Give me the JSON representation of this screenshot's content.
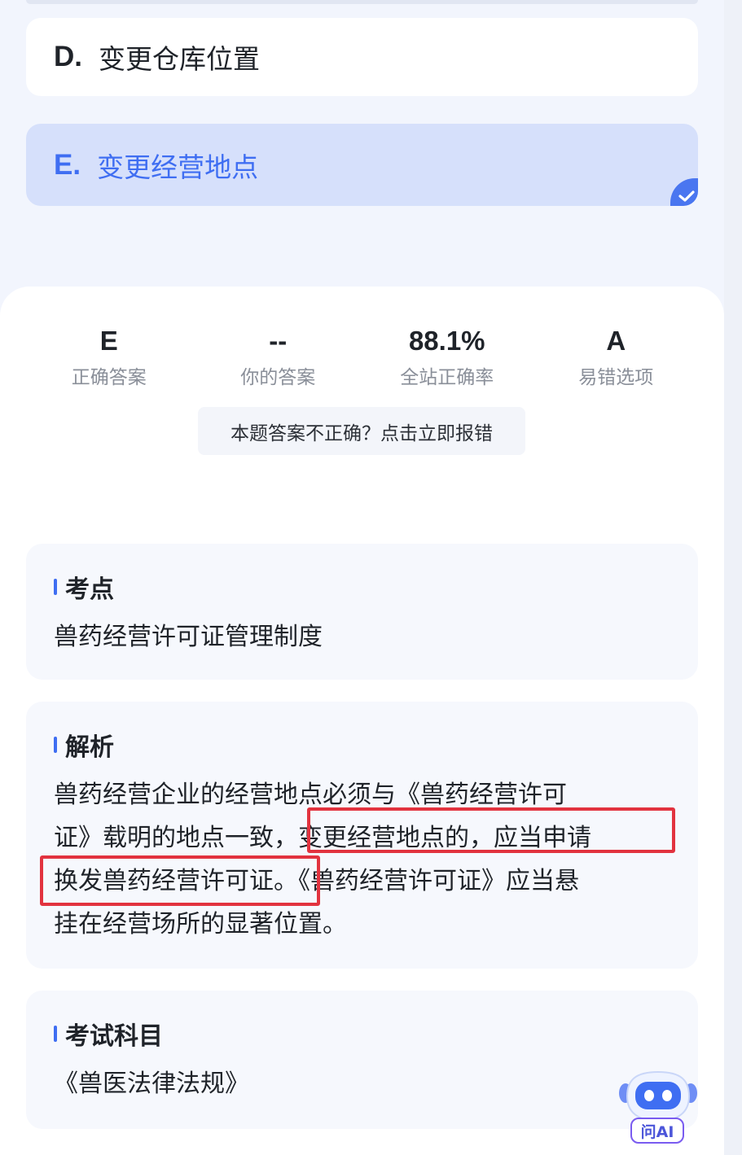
{
  "options": [
    {
      "letter": "D.",
      "text": "变更仓库位置",
      "selected": false
    },
    {
      "letter": "E.",
      "text": "变更经营地点",
      "selected": true
    }
  ],
  "stats": [
    {
      "value": "E",
      "label": "正确答案"
    },
    {
      "value": "--",
      "label": "你的答案"
    },
    {
      "value": "88.1%",
      "label": "全站正确率"
    },
    {
      "value": "A",
      "label": "易错选项"
    }
  ],
  "report_button": "本题答案不正确？点击立即报错",
  "key_point": {
    "title": "考点",
    "body": "兽药经营许可证管理制度"
  },
  "analysis": {
    "title": "解析",
    "lines": [
      "兽药经营企业的经营地点必须与《兽药经营许可",
      "证》载明的地点一致，变更经营地点的，应当申请",
      "换发兽药经营许可证。《兽药经营许可证》应当悬",
      "挂在经营场所的显著位置。"
    ]
  },
  "subject": {
    "title": "考试科目",
    "body": "《兽医法律法规》"
  },
  "ai_button": "问AI",
  "colors": {
    "accent": "#3f6ef2",
    "highlight": "#e2333f",
    "selected_bg": "#d6e0fb"
  },
  "icons": {
    "selected": "check-icon",
    "assistant": "robot-icon"
  }
}
